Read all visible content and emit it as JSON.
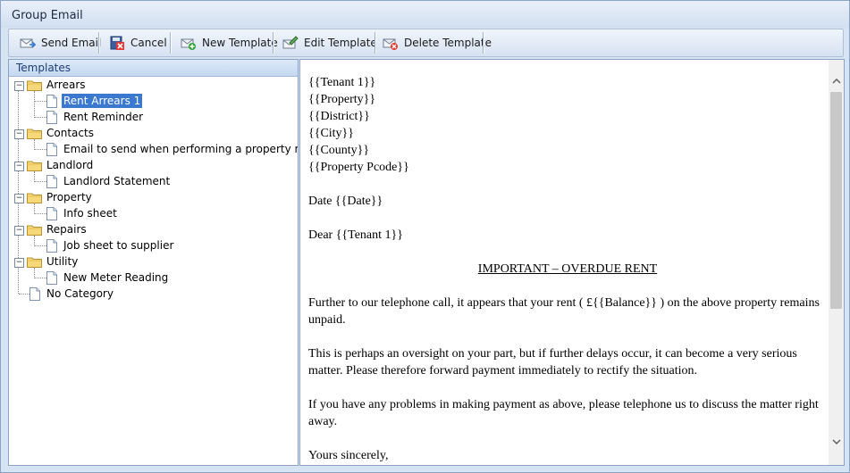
{
  "window": {
    "title": "Group Email"
  },
  "toolbar": {
    "buttons": [
      {
        "label": "Send Email",
        "icon": "send-email-icon"
      },
      {
        "label": "Cancel",
        "icon": "cancel-icon"
      },
      {
        "label": "New Template",
        "icon": "new-template-icon"
      },
      {
        "label": "Edit Template",
        "icon": "edit-template-icon"
      },
      {
        "label": "Delete Template",
        "icon": "delete-template-icon"
      }
    ]
  },
  "templates_pane": {
    "header": "Templates",
    "categories": [
      {
        "label": "Arrears",
        "items": [
          "Rent Arrears 1",
          "Rent Reminder"
        ]
      },
      {
        "label": "Contacts",
        "items": [
          "Email to send when performing a property match"
        ]
      },
      {
        "label": "Landlord",
        "items": [
          "Landlord Statement"
        ]
      },
      {
        "label": "Property",
        "items": [
          "Info sheet"
        ]
      },
      {
        "label": "Repairs",
        "items": [
          "Job sheet to supplier"
        ]
      },
      {
        "label": "Utility",
        "items": [
          "New Meter Reading"
        ]
      }
    ],
    "uncategorized": "No Category",
    "selected": "Rent Arrears 1"
  },
  "document": {
    "address_lines": [
      "{{Tenant 1}}",
      "{{Property}}",
      "{{District}}",
      "{{City}}",
      "{{County}}",
      "{{Property Pcode}}"
    ],
    "date_line": "Date {{Date}}",
    "salutation": "Dear {{Tenant 1}}",
    "heading": "IMPORTANT – OVERDUE RENT",
    "paragraphs": [
      "Further to our telephone call, it appears that your rent ( £{{Balance}} ) on the above property remains unpaid.",
      "This is perhaps an oversight on your part, but if further delays occur, it can become a very serious matter. Please therefore forward payment immediately to rectify the situation.",
      "If you have any problems in making payment as above, please telephone us to discuss the matter right away."
    ],
    "closing": "Yours sincerely,"
  },
  "colors": {
    "selection": "#3b78d0",
    "header_text": "#1d3e73"
  }
}
